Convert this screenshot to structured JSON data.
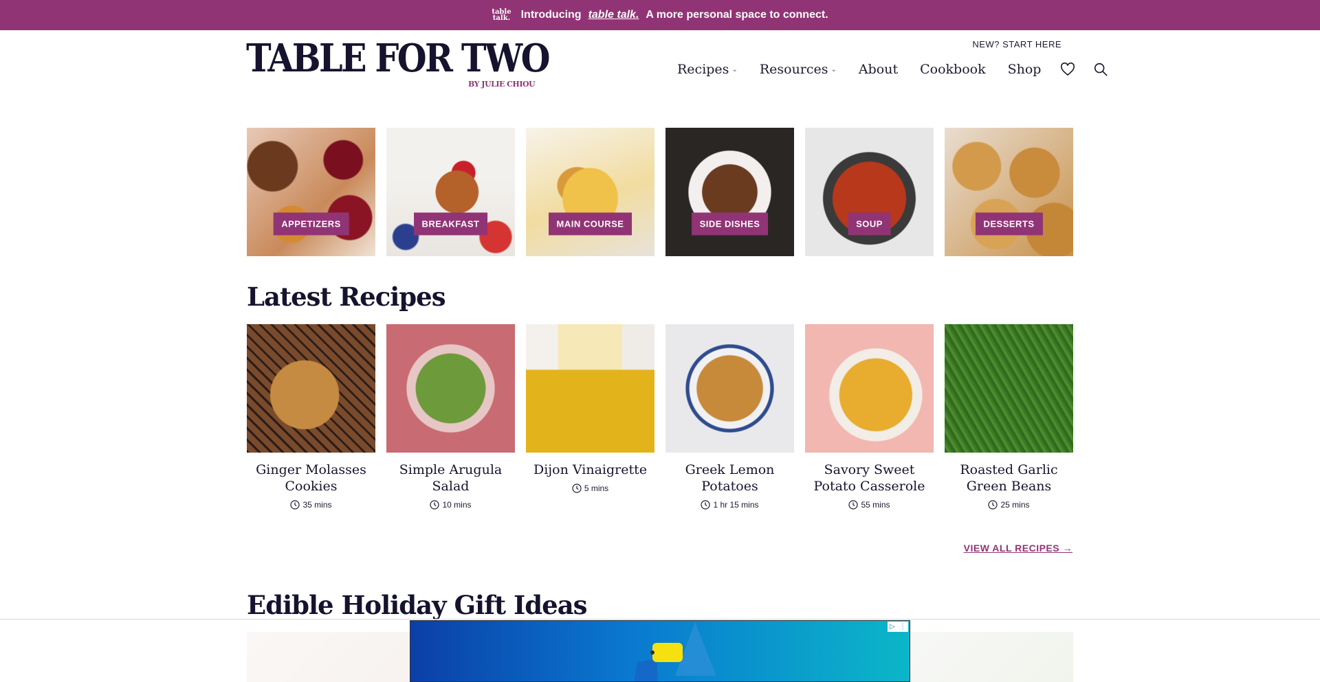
{
  "announcement": {
    "logo_text_1": "table",
    "logo_text_2": "talk.",
    "intro": "Introducing",
    "link": "table talk.",
    "rest": "A more personal space to connect."
  },
  "header": {
    "logo_main": "TABLE FOR TWO",
    "logo_sub": "BY JULIE CHIOU",
    "new_start": "NEW? START HERE",
    "nav": [
      {
        "label": "Recipes",
        "has_dropdown": true
      },
      {
        "label": "Resources",
        "has_dropdown": true
      },
      {
        "label": "About",
        "has_dropdown": false
      },
      {
        "label": "Cookbook",
        "has_dropdown": false
      },
      {
        "label": "Shop",
        "has_dropdown": false
      }
    ],
    "icons": [
      "heart-icon",
      "search-icon"
    ]
  },
  "categories": [
    {
      "label": "APPETIZERS"
    },
    {
      "label": "BREAKFAST"
    },
    {
      "label": "MAIN COURSE"
    },
    {
      "label": "SIDE DISHES"
    },
    {
      "label": "SOUP"
    },
    {
      "label": "DESSERTS"
    }
  ],
  "latest": {
    "title": "Latest Recipes",
    "items": [
      {
        "title": "Ginger Molasses Cookies",
        "time": "35 mins"
      },
      {
        "title": "Simple Arugula Salad",
        "time": "10 mins"
      },
      {
        "title": "Dijon Vinaigrette",
        "time": "5 mins"
      },
      {
        "title": "Greek Lemon Potatoes",
        "time": "1 hr 15 mins"
      },
      {
        "title": "Savory Sweet Potato Casserole",
        "time": "55 mins"
      },
      {
        "title": "Roasted Garlic Green Beans",
        "time": "25 mins"
      }
    ],
    "view_all": "VIEW ALL RECIPES →"
  },
  "gifts": {
    "title": "Edible Holiday Gift Ideas"
  },
  "colors": {
    "brand": "#913475",
    "navy": "#15132e"
  }
}
